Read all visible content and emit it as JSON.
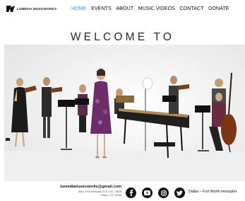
{
  "brand": {
    "name": "LUMEDIA MUSICWORKS"
  },
  "nav": {
    "items": [
      {
        "label": "HOME",
        "active": true
      },
      {
        "label": "EVENTS",
        "active": false
      },
      {
        "label": "ABOUT",
        "active": false
      },
      {
        "label": "MUSIC VIDEOS",
        "active": false
      },
      {
        "label": "CONTACT",
        "active": false
      },
      {
        "label": "DONATE",
        "active": false
      }
    ]
  },
  "page": {
    "title": "WELCOME TO"
  },
  "hero": {
    "image_description_icon": "ensemble-photo"
  },
  "footer": {
    "email": "lumediamusicworks@gmail.com",
    "address_line1": "8811 Teel Parkway STE 100 - 5825",
    "address_line2": "Frisco, TX 75035",
    "socials": [
      {
        "icon": "facebook-icon"
      },
      {
        "icon": "youtube-icon"
      },
      {
        "icon": "instagram-icon"
      },
      {
        "icon": "twitter-icon"
      }
    ],
    "metro": "Dallas – Fort Worth metroplex"
  },
  "colors": {
    "nav_active": "#3aa0ff",
    "text": "#111111",
    "social_bg": "#111111"
  }
}
